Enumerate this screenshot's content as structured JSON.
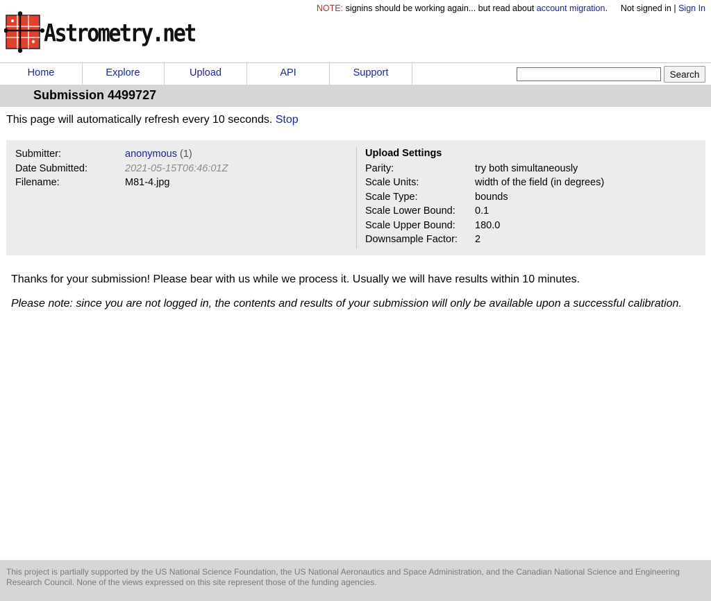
{
  "top_notice": {
    "note_label": "NOTE:",
    "note_text": "signins should be working again... but read about",
    "note_link": "account migration",
    "note_end": ".",
    "signed_status": "Not signed in |",
    "signin_link": "Sign In"
  },
  "logo": {
    "text": "Astrometry.net"
  },
  "nav": {
    "items": [
      "Home",
      "Explore",
      "Upload",
      "API",
      "Support"
    ],
    "search_value": "",
    "search_button": "Search"
  },
  "title": "Submission 4499727",
  "refresh": {
    "text": "This page will automatically refresh every 10 seconds.",
    "stop_link": "Stop"
  },
  "submission": {
    "submitter_label": "Submitter:",
    "submitter_value": "anonymous",
    "submitter_count": "(1)",
    "date_label": "Date Submitted:",
    "date_value": "2021-05-15T06:46:01Z",
    "filename_label": "Filename:",
    "filename_value": "M81-4.jpg"
  },
  "upload_settings": {
    "heading": "Upload Settings",
    "rows": [
      {
        "label": "Parity:",
        "value": "try both simultaneously"
      },
      {
        "label": "Scale Units:",
        "value": "width of the field (in degrees)"
      },
      {
        "label": "Scale Type:",
        "value": "bounds"
      },
      {
        "label": "Scale Lower Bound:",
        "value": "0.1"
      },
      {
        "label": "Scale Upper Bound:",
        "value": "180.0"
      },
      {
        "label": "Downsample Factor:",
        "value": "2"
      }
    ]
  },
  "thanks_text": "Thanks for your submission! Please bear with us while we process it. Usually we will have results within 10 minutes.",
  "note_italic": "Please note: since you are not logged in, the contents and results of your submission will only be available upon a successful calibration.",
  "footer_text": "This project is partially supported by the US National Science Foundation, the US National Aeronautics and Space Administration, and the Canadian National Science and Engineering Research Council. None of the views expressed on this site represent those of the funding agencies.",
  "colors": {
    "link": "#1a24a0",
    "note_red": "#e0201a",
    "logo_red": "#e2412e",
    "band_gray": "#d6d6d6",
    "box_gray": "#ececec"
  }
}
